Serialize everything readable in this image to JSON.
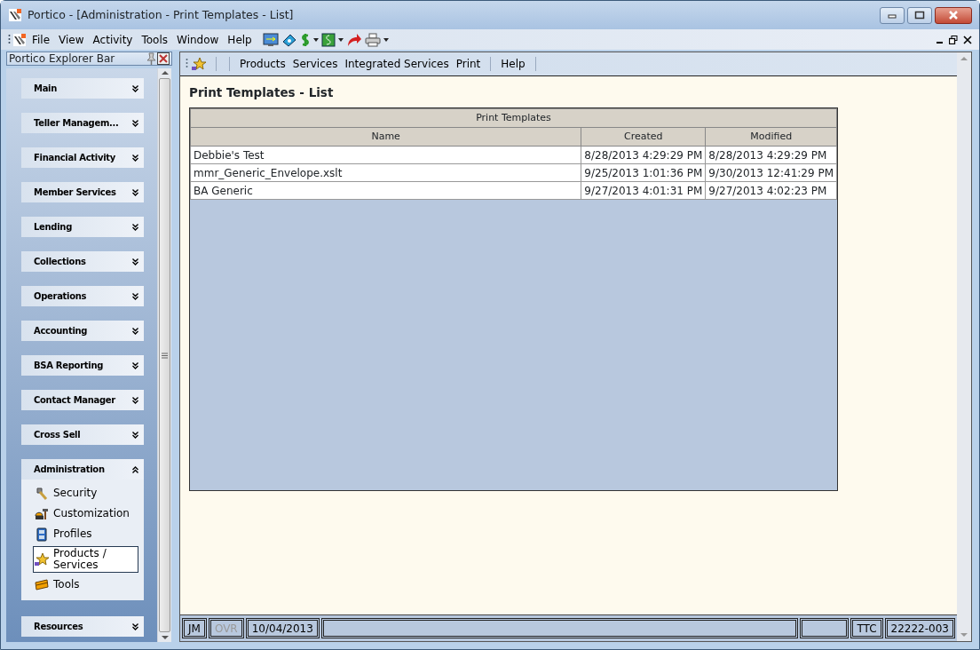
{
  "window": {
    "title": "Portico - [Administration - Print Templates - List]"
  },
  "menu": {
    "items": [
      "File",
      "View",
      "Activity",
      "Tools",
      "Window",
      "Help"
    ]
  },
  "explorer": {
    "title": "Portico Explorer Bar",
    "groups": [
      {
        "label": "Main",
        "expanded": false
      },
      {
        "label": "Teller Managem...",
        "expanded": false
      },
      {
        "label": "Financial Activity",
        "expanded": false
      },
      {
        "label": "Member Services",
        "expanded": false
      },
      {
        "label": "Lending",
        "expanded": false
      },
      {
        "label": "Collections",
        "expanded": false
      },
      {
        "label": "Operations",
        "expanded": false
      },
      {
        "label": "Accounting",
        "expanded": false
      },
      {
        "label": "BSA Reporting",
        "expanded": false
      },
      {
        "label": "Contact Manager",
        "expanded": false
      },
      {
        "label": "Cross Sell",
        "expanded": false
      },
      {
        "label": "Administration",
        "expanded": true,
        "items": [
          {
            "label": "Security",
            "kind": "keys",
            "selected": false
          },
          {
            "label": "Customization",
            "kind": "tools",
            "selected": false
          },
          {
            "label": "Profiles",
            "kind": "cabinet",
            "selected": false
          },
          {
            "label": "Products / Services",
            "kind": "star",
            "selected": true
          },
          {
            "label": "Tools",
            "kind": "toolbox",
            "selected": false
          }
        ]
      },
      {
        "label": "Resources",
        "expanded": false
      }
    ]
  },
  "content_toolbar": {
    "items": [
      "Products",
      "Services",
      "Integrated Services",
      "Print",
      "Help"
    ]
  },
  "page_title": "Print Templates - List",
  "table": {
    "caption": "Print Templates",
    "columns": [
      "Name",
      "Created",
      "Modified"
    ],
    "rows": [
      [
        "Debbie's Test",
        "8/28/2013 4:29:29 PM",
        "8/28/2013 4:29:29 PM"
      ],
      [
        "mmr_Generic_Envelope.xslt",
        "9/25/2013 1:01:36 PM",
        "9/30/2013 12:41:29 PM"
      ],
      [
        "BA Generic",
        "9/27/2013 4:01:31 PM",
        "9/27/2013 4:02:23 PM"
      ]
    ]
  },
  "status_bar": {
    "fields": [
      {
        "text": "JM",
        "disabled": false
      },
      {
        "text": "OVR",
        "disabled": true
      },
      {
        "text": "10/04/2013",
        "disabled": false
      },
      {
        "kind": "blank-wide"
      },
      {
        "kind": "blank"
      },
      {
        "text": "TTC",
        "disabled": false
      },
      {
        "text": "22222-003",
        "disabled": false
      }
    ]
  }
}
